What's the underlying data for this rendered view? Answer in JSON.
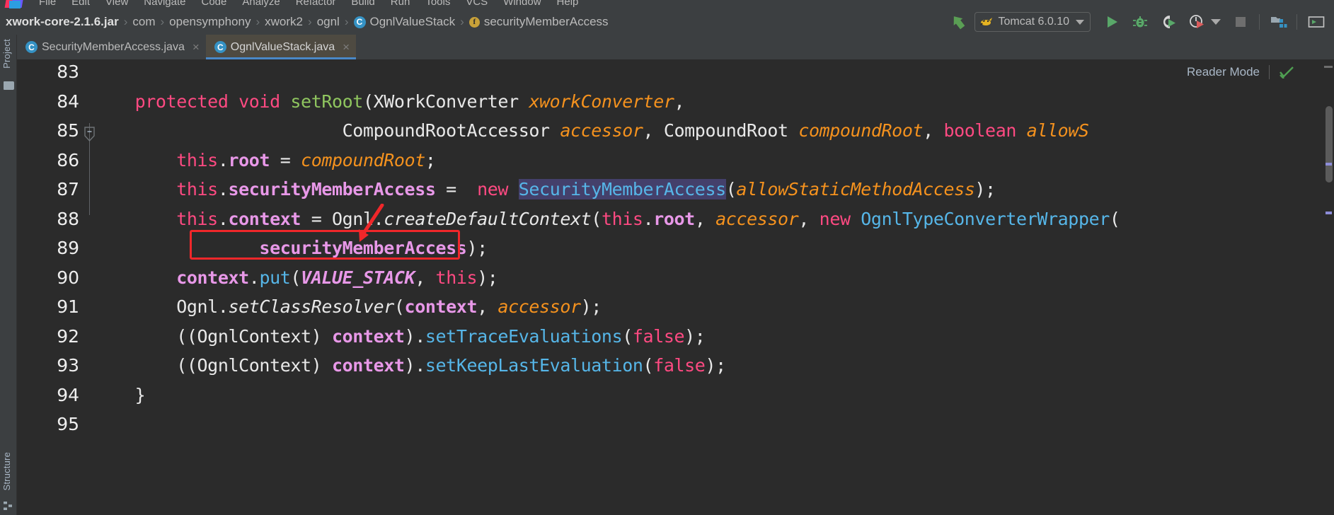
{
  "app": {
    "theme_bg": "#2b2b2b",
    "chrome_bg": "#3c3f41",
    "accent": "#4a88c7",
    "annotation_color": "#f0272a"
  },
  "menubar": {
    "logo": "intellij-idea-logo",
    "items": [
      {
        "label": "File"
      },
      {
        "label": "Edit"
      },
      {
        "label": "View"
      },
      {
        "label": "Navigate"
      },
      {
        "label": "Code"
      },
      {
        "label": "Analyze"
      },
      {
        "label": "Refactor"
      },
      {
        "label": "Build"
      },
      {
        "label": "Run"
      },
      {
        "label": "Tools"
      },
      {
        "label": "VCS"
      },
      {
        "label": "Window"
      },
      {
        "label": "Help"
      }
    ]
  },
  "breadcrumb": {
    "separator": "›",
    "items": [
      {
        "label": "xwork-core-2.1.6.jar",
        "icon": null,
        "bold": true
      },
      {
        "label": "com",
        "icon": null,
        "bold": false
      },
      {
        "label": "opensymphony",
        "icon": null,
        "bold": false
      },
      {
        "label": "xwork2",
        "icon": null,
        "bold": false
      },
      {
        "label": "ognl",
        "icon": null,
        "bold": false
      },
      {
        "label": "OgnlValueStack",
        "icon": "class-icon",
        "icon_letter": "C",
        "bold": false
      },
      {
        "label": "securityMemberAccess",
        "icon": "field-icon",
        "icon_letter": "f",
        "bold": false
      }
    ]
  },
  "toolbar": {
    "build_icon": "hammer-icon",
    "run_config": {
      "name": "Tomcat 6.0.10",
      "icon": "tomcat-icon",
      "dropdown": "chevron-down-icon"
    },
    "buttons": [
      {
        "name": "run-button",
        "icon": "play-icon"
      },
      {
        "name": "debug-button",
        "icon": "bug-icon"
      },
      {
        "name": "run-with-coverage-button",
        "icon": "coverage-icon"
      },
      {
        "name": "profile-button",
        "icon": "profiler-icon"
      },
      {
        "name": "profile-dropdown",
        "icon": "chevron-down-icon"
      },
      {
        "name": "stop-button",
        "icon": "stop-icon"
      },
      {
        "name": "project-structure-button",
        "icon": "project-structure-icon"
      },
      {
        "name": "terminal-button",
        "icon": "terminal-icon"
      }
    ]
  },
  "tool_stripes": {
    "left": [
      {
        "label": "Project",
        "icon": "project-folder-icon"
      },
      {
        "label": "Structure",
        "icon": "structure-icon"
      }
    ]
  },
  "tabs": [
    {
      "label": "SecurityMemberAccess.java",
      "icon": "java-class-icon",
      "active": false,
      "close": "×"
    },
    {
      "label": "OgnlValueStack.java",
      "icon": "java-class-icon",
      "active": true,
      "close": "×"
    }
  ],
  "editor": {
    "reader_mode_label": "Reader Mode",
    "reader_mode_check": "check-icon",
    "first_line": 83,
    "gutter_lines": [
      "83",
      "84",
      "85",
      "86",
      "87",
      "88",
      "89",
      "90",
      "91",
      "92",
      "93",
      "94",
      "95"
    ],
    "fold_marker_line": "85",
    "code": [
      {
        "line": "83",
        "tokens": []
      },
      {
        "line": "84",
        "tokens": [
          {
            "t": "    ",
            "c": "cls"
          },
          {
            "t": "protected void ",
            "c": "kw2"
          },
          {
            "t": "setRoot",
            "c": "mth"
          },
          {
            "t": "(XWorkConverter ",
            "c": "cls"
          },
          {
            "t": "xworkConverter",
            "c": "par"
          },
          {
            "t": ",",
            "c": "cls"
          }
        ]
      },
      {
        "line": "85",
        "tokens": [
          {
            "t": "                        CompoundRootAccessor ",
            "c": "cls"
          },
          {
            "t": "accessor",
            "c": "par"
          },
          {
            "t": ", CompoundRoot ",
            "c": "cls"
          },
          {
            "t": "compoundRoot",
            "c": "par"
          },
          {
            "t": ", ",
            "c": "cls"
          },
          {
            "t": "boolean ",
            "c": "kw2"
          },
          {
            "t": "allowS",
            "c": "par"
          }
        ]
      },
      {
        "line": "86",
        "tokens": [
          {
            "t": "        ",
            "c": "cls"
          },
          {
            "t": "this",
            "c": "kw2"
          },
          {
            "t": ".",
            "c": "cls"
          },
          {
            "t": "root",
            "c": "fld"
          },
          {
            "t": " = ",
            "c": "cls"
          },
          {
            "t": "compoundRoot",
            "c": "par"
          },
          {
            "t": ";",
            "c": "cls"
          }
        ]
      },
      {
        "line": "87",
        "tokens": [
          {
            "t": "        ",
            "c": "cls"
          },
          {
            "t": "this",
            "c": "kw2"
          },
          {
            "t": ".",
            "c": "cls"
          },
          {
            "t": "securityMemberAccess",
            "c": "fld"
          },
          {
            "t": " =  ",
            "c": "cls"
          },
          {
            "t": "new ",
            "c": "kw2"
          },
          {
            "t": "SecurityMemberAccess",
            "c": "typ sel"
          },
          {
            "t": "(",
            "c": "cls"
          },
          {
            "t": "allowStaticMethodAccess",
            "c": "par"
          },
          {
            "t": ");",
            "c": "cls"
          }
        ]
      },
      {
        "line": "88",
        "tokens": [
          {
            "t": "        ",
            "c": "cls"
          },
          {
            "t": "this",
            "c": "kw2"
          },
          {
            "t": ".",
            "c": "cls"
          },
          {
            "t": "context",
            "c": "fld"
          },
          {
            "t": " = Ognl.",
            "c": "cls"
          },
          {
            "t": "createDefaultContext",
            "c": "itl"
          },
          {
            "t": "(",
            "c": "cls"
          },
          {
            "t": "this",
            "c": "kw2"
          },
          {
            "t": ".",
            "c": "cls"
          },
          {
            "t": "root",
            "c": "fld"
          },
          {
            "t": ", ",
            "c": "cls"
          },
          {
            "t": "accessor",
            "c": "par"
          },
          {
            "t": ", ",
            "c": "cls"
          },
          {
            "t": "new ",
            "c": "kw2"
          },
          {
            "t": "OgnlTypeConverterWrapper",
            "c": "typ"
          },
          {
            "t": "(",
            "c": "cls"
          }
        ]
      },
      {
        "line": "89",
        "tokens": [
          {
            "t": "                ",
            "c": "cls"
          },
          {
            "t": "securityMemberAccess",
            "c": "fld"
          },
          {
            "t": ");",
            "c": "cls"
          }
        ]
      },
      {
        "line": "90",
        "tokens": [
          {
            "t": "        ",
            "c": "cls"
          },
          {
            "t": "context",
            "c": "fld"
          },
          {
            "t": ".",
            "c": "cls"
          },
          {
            "t": "put",
            "c": "typ"
          },
          {
            "t": "(",
            "c": "cls"
          },
          {
            "t": "VALUE_STACK",
            "c": "fld2"
          },
          {
            "t": ", ",
            "c": "cls"
          },
          {
            "t": "this",
            "c": "kw2"
          },
          {
            "t": ");",
            "c": "cls"
          }
        ]
      },
      {
        "line": "91",
        "tokens": [
          {
            "t": "        Ognl.",
            "c": "cls"
          },
          {
            "t": "setClassResolver",
            "c": "itl"
          },
          {
            "t": "(",
            "c": "cls"
          },
          {
            "t": "context",
            "c": "fld"
          },
          {
            "t": ", ",
            "c": "cls"
          },
          {
            "t": "accessor",
            "c": "par"
          },
          {
            "t": ");",
            "c": "cls"
          }
        ]
      },
      {
        "line": "92",
        "tokens": [
          {
            "t": "        ((OgnlContext) ",
            "c": "cls"
          },
          {
            "t": "context",
            "c": "fld"
          },
          {
            "t": ").",
            "c": "cls"
          },
          {
            "t": "setTraceEvaluations",
            "c": "typ"
          },
          {
            "t": "(",
            "c": "cls"
          },
          {
            "t": "false",
            "c": "kw2"
          },
          {
            "t": ");",
            "c": "cls"
          }
        ]
      },
      {
        "line": "93",
        "tokens": [
          {
            "t": "        ((OgnlContext) ",
            "c": "cls"
          },
          {
            "t": "context",
            "c": "fld"
          },
          {
            "t": ").",
            "c": "cls"
          },
          {
            "t": "setKeepLastEvaluation",
            "c": "typ"
          },
          {
            "t": "(",
            "c": "cls"
          },
          {
            "t": "false",
            "c": "kw2"
          },
          {
            "t": ");",
            "c": "cls"
          }
        ]
      },
      {
        "line": "94",
        "tokens": [
          {
            "t": "    }",
            "c": "cls"
          }
        ]
      },
      {
        "line": "95",
        "tokens": []
      }
    ]
  },
  "annotation": {
    "type": "red-box-with-arrow",
    "target_line": "89",
    "target_text": "securityMemberAccess);",
    "color": "#f0272a"
  }
}
